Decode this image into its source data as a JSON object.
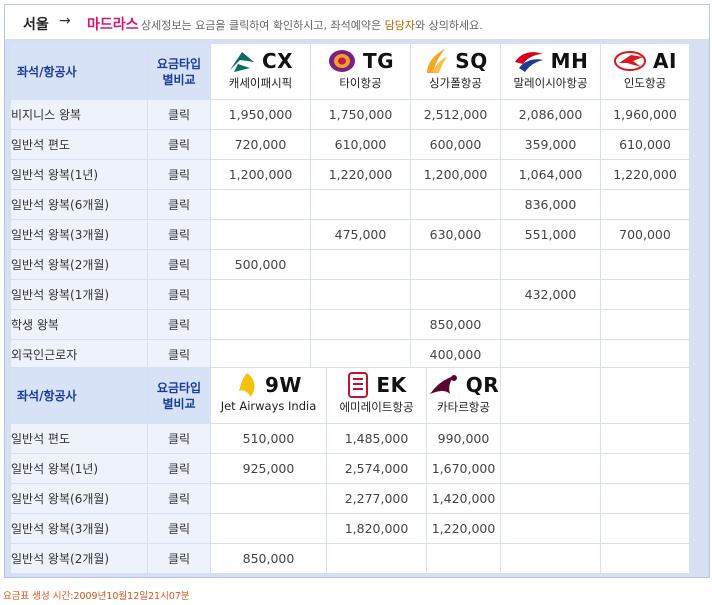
{
  "header": {
    "from": "서울",
    "arrow": "→",
    "to": "마드라스",
    "note_prefix": "상세정보는 요금을 클릭하여 확인하시고, 좌석예약은",
    "note_highlight": "담당자",
    "note_suffix": "와 상의하세요."
  },
  "table1": {
    "col_seat": "좌석/항공사",
    "col_compare_line1": "요금타입",
    "col_compare_line2": "별비교",
    "airlines": [
      {
        "code": "CX",
        "name": "캐세이패시픽",
        "icon": "cathay-pacific-logo-icon"
      },
      {
        "code": "TG",
        "name": "타이항공",
        "icon": "thai-airways-logo-icon"
      },
      {
        "code": "SQ",
        "name": "싱가폴항공",
        "icon": "singapore-airlines-logo-icon"
      },
      {
        "code": "MH",
        "name": "말레이시아항공",
        "icon": "malaysia-airlines-logo-icon"
      },
      {
        "code": "AI",
        "name": "인도항공",
        "icon": "air-india-logo-icon"
      }
    ],
    "rows": [
      {
        "label": "비지니스 왕복",
        "compare": "클릭",
        "prices": [
          "1,950,000",
          "1,750,000",
          "2,512,000",
          "2,086,000",
          "1,960,000"
        ]
      },
      {
        "label": "일반석 편도",
        "compare": "클릭",
        "prices": [
          "720,000",
          "610,000",
          "600,000",
          "359,000",
          "610,000"
        ]
      },
      {
        "label": "일반석 왕복(1년)",
        "compare": "클릭",
        "prices": [
          "1,200,000",
          "1,220,000",
          "1,200,000",
          "1,064,000",
          "1,220,000"
        ]
      },
      {
        "label": "일반석 왕복(6개월)",
        "compare": "클릭",
        "prices": [
          "",
          "",
          "",
          "836,000",
          ""
        ]
      },
      {
        "label": "일반석 왕복(3개월)",
        "compare": "클릭",
        "prices": [
          "",
          "475,000",
          "630,000",
          "551,000",
          "700,000"
        ]
      },
      {
        "label": "일반석 왕복(2개월)",
        "compare": "클릭",
        "prices": [
          "500,000",
          "",
          "",
          "",
          ""
        ]
      },
      {
        "label": "일반석 왕복(1개월)",
        "compare": "클릭",
        "prices": [
          "",
          "",
          "",
          "432,000",
          ""
        ]
      },
      {
        "label": "학생 왕복",
        "compare": "클릭",
        "prices": [
          "",
          "",
          "850,000",
          "",
          ""
        ]
      },
      {
        "label": "외국인근로자",
        "compare": "클릭",
        "prices": [
          "",
          "",
          "400,000",
          "",
          ""
        ]
      }
    ]
  },
  "table2": {
    "col_seat": "좌석/항공사",
    "col_compare_line1": "요금타입",
    "col_compare_line2": "별비교",
    "airlines": [
      {
        "code": "9W",
        "name": "Jet Airways India",
        "icon": "jet-airways-logo-icon"
      },
      {
        "code": "EK",
        "name": "에미레이트항공",
        "icon": "emirates-logo-icon"
      },
      {
        "code": "QR",
        "name": "카타르항공",
        "icon": "qatar-airways-logo-icon"
      }
    ],
    "rows": [
      {
        "label": "일반석 편도",
        "compare": "클릭",
        "prices": [
          "510,000",
          "1,485,000",
          "990,000"
        ]
      },
      {
        "label": "일반석 왕복(1년)",
        "compare": "클릭",
        "prices": [
          "925,000",
          "2,574,000",
          "1,670,000"
        ]
      },
      {
        "label": "일반석 왕복(6개월)",
        "compare": "클릭",
        "prices": [
          "",
          "2,277,000",
          "1,420,000"
        ]
      },
      {
        "label": "일반석 왕복(3개월)",
        "compare": "클릭",
        "prices": [
          "",
          "1,820,000",
          "1,220,000"
        ]
      },
      {
        "label": "일반석 왕복(2개월)",
        "compare": "클릭",
        "prices": [
          "850,000",
          "",
          ""
        ]
      }
    ]
  },
  "footer": {
    "text": "요금표 생성 시간:2009년10월12일21시07분"
  },
  "colors": {
    "header_bg": "#d8e2f6",
    "header_text": "#1a3d9a",
    "destination": "#d2166f",
    "footer_text": "#d5551a"
  }
}
